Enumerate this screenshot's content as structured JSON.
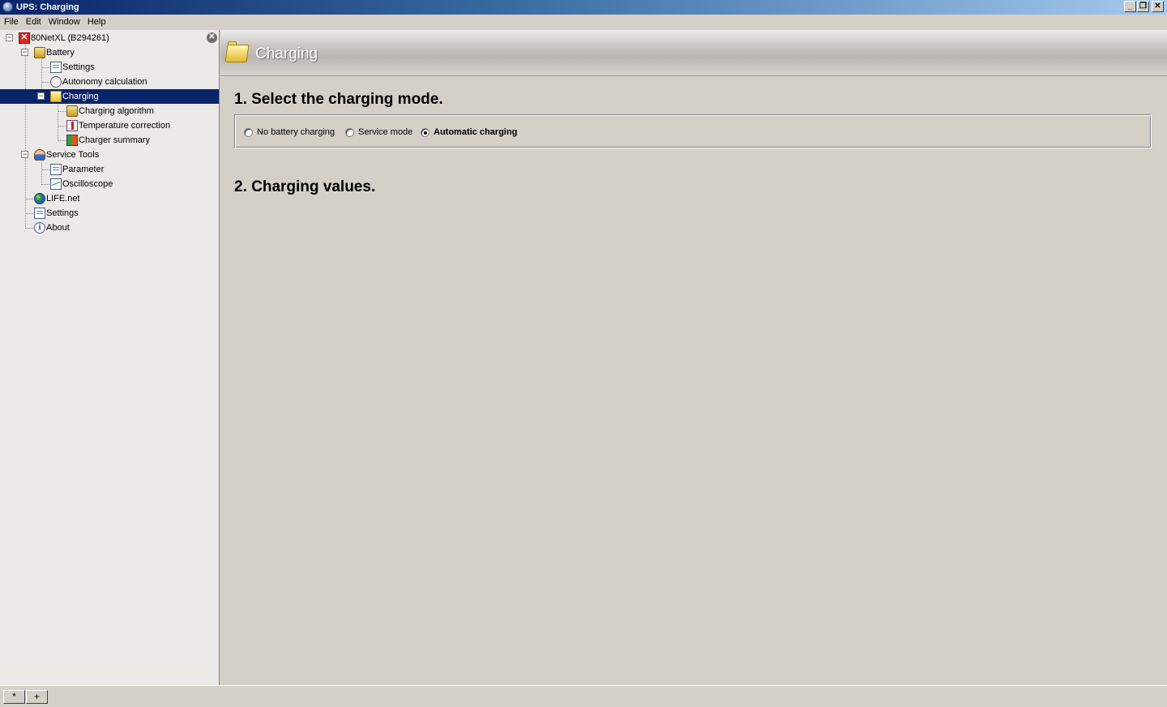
{
  "window": {
    "title": "UPS: Charging",
    "controls": {
      "minimize": "_",
      "restore": "❐",
      "close": "✕"
    }
  },
  "menu": [
    "File",
    "Edit",
    "Window",
    "Help"
  ],
  "tree": {
    "root": "80NetXL (B294261)",
    "battery": "Battery",
    "battery_settings": "Settings",
    "autonomy": "Autonomy calculation",
    "charging": "Charging",
    "charging_algorithm": "Charging algorithm",
    "temperature_correction": "Temperature correction",
    "charger_summary": "Charger summary",
    "service_tools": "Service Tools",
    "parameter": "Parameter",
    "oscilloscope": "Oscilloscope",
    "lifenet": "LIFE.net",
    "settings": "Settings",
    "about": "About",
    "selected": "Charging"
  },
  "main": {
    "header_title": "Charging",
    "section1_title": "1. Select the charging mode.",
    "modes": [
      {
        "label": "No battery charging",
        "selected": false
      },
      {
        "label": "Service mode",
        "selected": false
      },
      {
        "label": "Automatic charging",
        "selected": true
      }
    ],
    "section2_title": "2. Charging values."
  },
  "bottom": {
    "btn1": "*",
    "btn2": "+"
  },
  "icons": {
    "root": "error-icon",
    "battery": "battery-icon",
    "settings": "document-icon",
    "autonomy": "stopwatch-icon",
    "charging": "folder-icon",
    "charging_algorithm": "battery-icon",
    "temperature_correction": "thermometer-icon",
    "charger_summary": "summary-icon",
    "service_tools": "person-icon",
    "parameter": "document-icon",
    "oscilloscope": "oscilloscope-icon",
    "lifenet": "globe-icon",
    "about": "info-icon"
  },
  "colors": {
    "selection": "#0a246a",
    "panel": "#d4d0c8",
    "tree_bg": "#eceae9"
  }
}
